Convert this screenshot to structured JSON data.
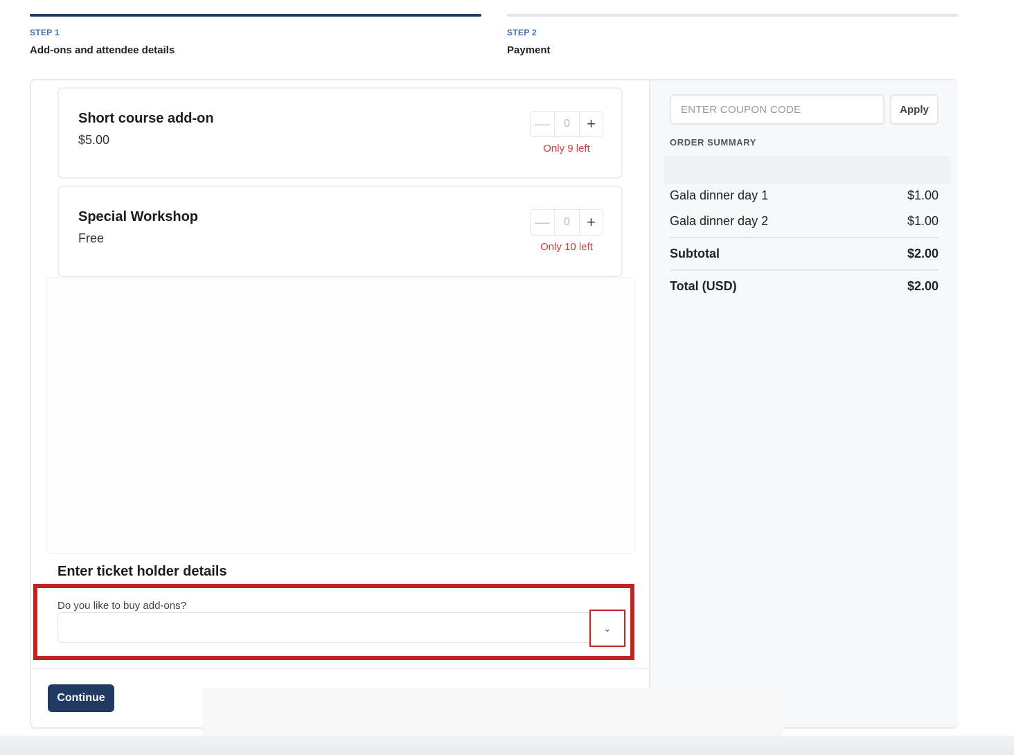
{
  "steps": [
    {
      "label": "STEP 1",
      "title": "Add-ons and attendee details"
    },
    {
      "label": "STEP 2",
      "title": "Payment"
    }
  ],
  "addons": [
    {
      "name": "Short course add-on",
      "price": "$5.00",
      "qty": "0",
      "availability": "Only 9 left"
    },
    {
      "name": "Special Workshop",
      "price": "Free",
      "qty": "0",
      "availability": "Only 10 left"
    }
  ],
  "stepper": {
    "minus": "—",
    "plus": "+"
  },
  "ticket_holder": {
    "title": "Enter ticket holder details",
    "question": "Do you like to buy add-ons?",
    "selected_value": "",
    "chevron": "chevron-down-icon"
  },
  "continue_label": "Continue",
  "coupon": {
    "placeholder": "ENTER COUPON CODE",
    "apply_label": "Apply"
  },
  "summary": {
    "title": "ORDER SUMMARY",
    "items": [
      {
        "label": "Gala dinner day 1",
        "amount": "$1.00"
      },
      {
        "label": "Gala dinner day 2",
        "amount": "$1.00"
      }
    ],
    "subtotal_label": "Subtotal",
    "subtotal": "$2.00",
    "total_label": "Total (USD)",
    "total": "$2.00"
  },
  "colors": {
    "primary": "#1f3b63",
    "step_label": "#3b6fb6",
    "warning": "#d23c3c",
    "highlight": "#c0261f"
  }
}
